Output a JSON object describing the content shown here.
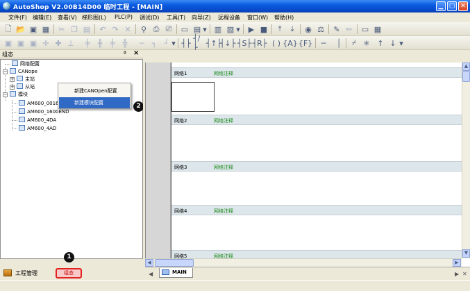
{
  "window": {
    "title": "AutoShop V2.00B14D00 临时工程 - [MAIN]",
    "controls": [
      "minimize-icon",
      "maximize-icon",
      "close-icon"
    ]
  },
  "menu": [
    "文件(F)",
    "编辑(E)",
    "查看(V)",
    "梯形图(L)",
    "PLC(P)",
    "调试(D)",
    "工具(T)",
    "向导(Z)",
    "远程设备",
    "窗口(W)",
    "帮助(H)"
  ],
  "left_pane": {
    "title": "组态",
    "pin": "ª",
    "close": "×",
    "tree": {
      "items": [
        {
          "label": "网络配置"
        },
        {
          "label": "CANope"
        },
        {
          "label": "主站"
        },
        {
          "label": "从站"
        },
        {
          "label": "模块"
        },
        {
          "label": "AM600_0016(ERN\\ETN\\ETP)"
        },
        {
          "label": "AM600_1600END"
        },
        {
          "label": "AM600_4DA"
        },
        {
          "label": "AM600_4AD"
        }
      ]
    },
    "context_menu": {
      "items": [
        {
          "label": "新建CANOpen配置",
          "highlighted": false
        },
        {
          "label": "新建模块配置",
          "highlighted": true
        }
      ]
    },
    "tabs": [
      {
        "label": "工程管理"
      },
      {
        "label": "组态"
      }
    ]
  },
  "callouts": {
    "one": "1",
    "two": "2"
  },
  "editor": {
    "networks": [
      {
        "number": "网络1",
        "comment": "网络注释"
      },
      {
        "number": "网络2",
        "comment": "网络注释"
      },
      {
        "number": "网络3",
        "comment": "网络注释"
      },
      {
        "number": "网络4",
        "comment": "网络注释"
      },
      {
        "number": "网络5",
        "comment": "网络注释"
      }
    ],
    "tab": "MAIN"
  },
  "toolbar_icons_row1": [
    "new-file-icon",
    "open-folder-icon",
    "save-icon",
    "save-all-icon",
    "cut-icon",
    "copy-icon",
    "paste-icon",
    "undo-icon",
    "redo-icon",
    "delete-icon",
    "find-icon",
    "print-preview-icon",
    "print-icon",
    "monitor-icon",
    "monitor-dropdown-icon",
    "io-table-icon",
    "io-dropdown-icon",
    "run-icon",
    "stop-icon",
    "upload-icon",
    "download-icon",
    "monitor-mode-icon",
    "compare-icon",
    "write-icon",
    "edit-icon",
    "view-icon",
    "list-icon"
  ],
  "toolbar_icons_row2": [
    "ladder-view-icon",
    "il-view-icon",
    "sfc-view-icon",
    "insert-row-icon",
    "delete-row-icon",
    "insert-column-icon",
    "branch-icon",
    "branch-start-icon",
    "branch-end-icon",
    "branch-up-icon",
    "hline-icon",
    "hline-rise-icon",
    "hline-fall-icon",
    "no-contact-icon",
    "nc-contact-icon",
    "rising-contact-icon",
    "falling-contact-icon",
    "set-contact-icon",
    "reset-contact-icon",
    "coil-icon",
    "function-icon",
    "func-block-icon",
    "horizontal-line-icon",
    "vertical-line-icon",
    "invert-icon",
    "delete-line-icon",
    "arrow-up-icon",
    "arrow-down-icon",
    "toolbar-dropdown-icon"
  ]
}
